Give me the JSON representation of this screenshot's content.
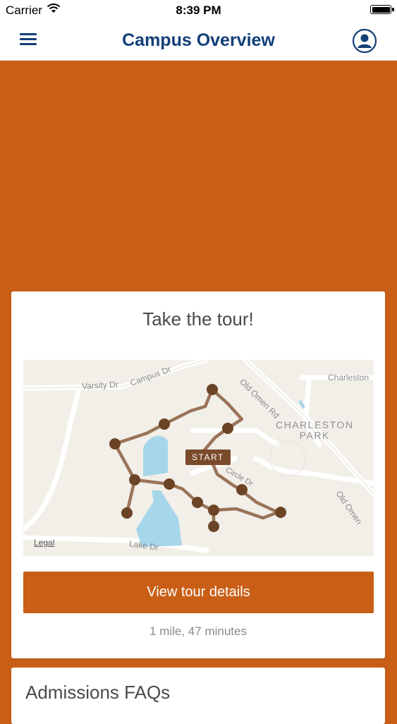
{
  "status_bar": {
    "carrier": "Carrier",
    "time": "8:39 PM",
    "icons": [
      "wifi-icon",
      "battery-icon"
    ]
  },
  "nav": {
    "title": "Campus Overview",
    "menu_icon": "hamburger-menu-icon",
    "profile_icon": "user-profile-icon",
    "title_color": "#123f78"
  },
  "colors": {
    "accent": "#c95f17",
    "route": "#9a7358",
    "stop": "#6b4426",
    "water": "#a6d6ea"
  },
  "tour_card": {
    "title": "Take the tour!",
    "map": {
      "street_labels": [
        "Varsity Dr",
        "Campus Dr",
        "Old Omen Rd",
        "Charleston",
        "Old Omen",
        "Circle Dr",
        "Lake Dr"
      ],
      "area_label": [
        "CHARLESTON",
        "PARK"
      ],
      "start_label": "START",
      "legal": "Legal"
    },
    "button_label": "View tour details",
    "meta": "1 mile, 47 minutes"
  },
  "faq_card": {
    "title": "Admissions FAQs"
  }
}
